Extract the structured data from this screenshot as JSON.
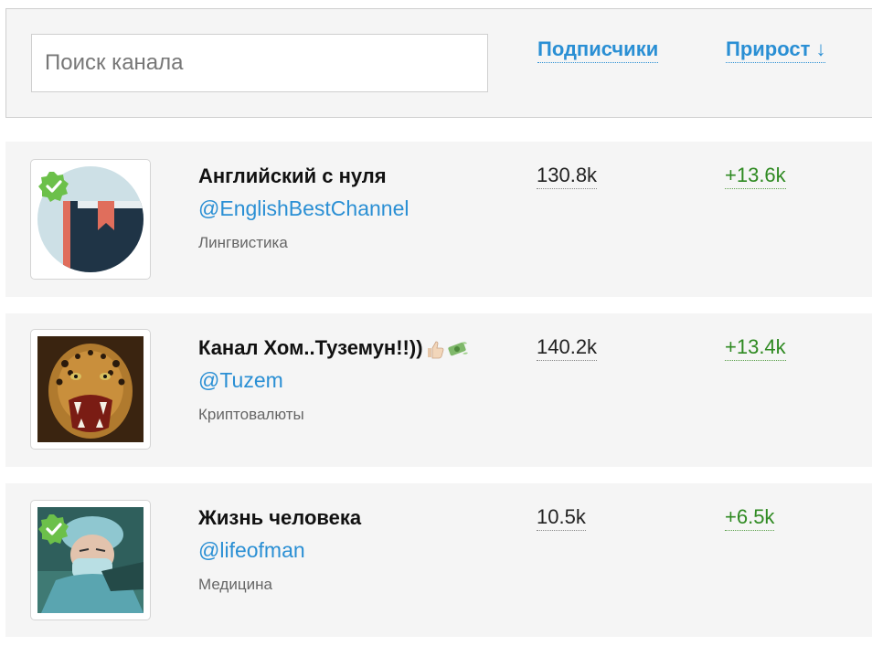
{
  "search": {
    "placeholder": "Поиск канала"
  },
  "sort": {
    "subscribers_label": "Подписчики",
    "growth_label": "Прирост ↓"
  },
  "colors": {
    "link": "#2a8fd4",
    "growth": "#2f8a22",
    "verified": "#6cc04a",
    "row_bg": "#f5f5f5"
  },
  "channels": [
    {
      "name": "Английский с нуля",
      "handle": "@EnglishBestChannel",
      "category": "Лингвистика",
      "subscribers": "130.8k",
      "growth": "+13.6k",
      "verified": true,
      "avatar_icon": "book-icon"
    },
    {
      "name": "Канал Хом..Туземун!!))",
      "handle": "@Tuzem",
      "category": "Криптовалюты",
      "subscribers": "140.2k",
      "growth": "+13.4k",
      "verified": false,
      "avatar_icon": "leopard-image",
      "emoji_icons": [
        "thumbs-up-icon",
        "money-icon"
      ]
    },
    {
      "name": "Жизнь человека",
      "handle": "@lifeofman",
      "category": "Медицина",
      "subscribers": "10.5k",
      "growth": "+6.5k",
      "verified": true,
      "avatar_icon": "surgeon-image"
    }
  ]
}
